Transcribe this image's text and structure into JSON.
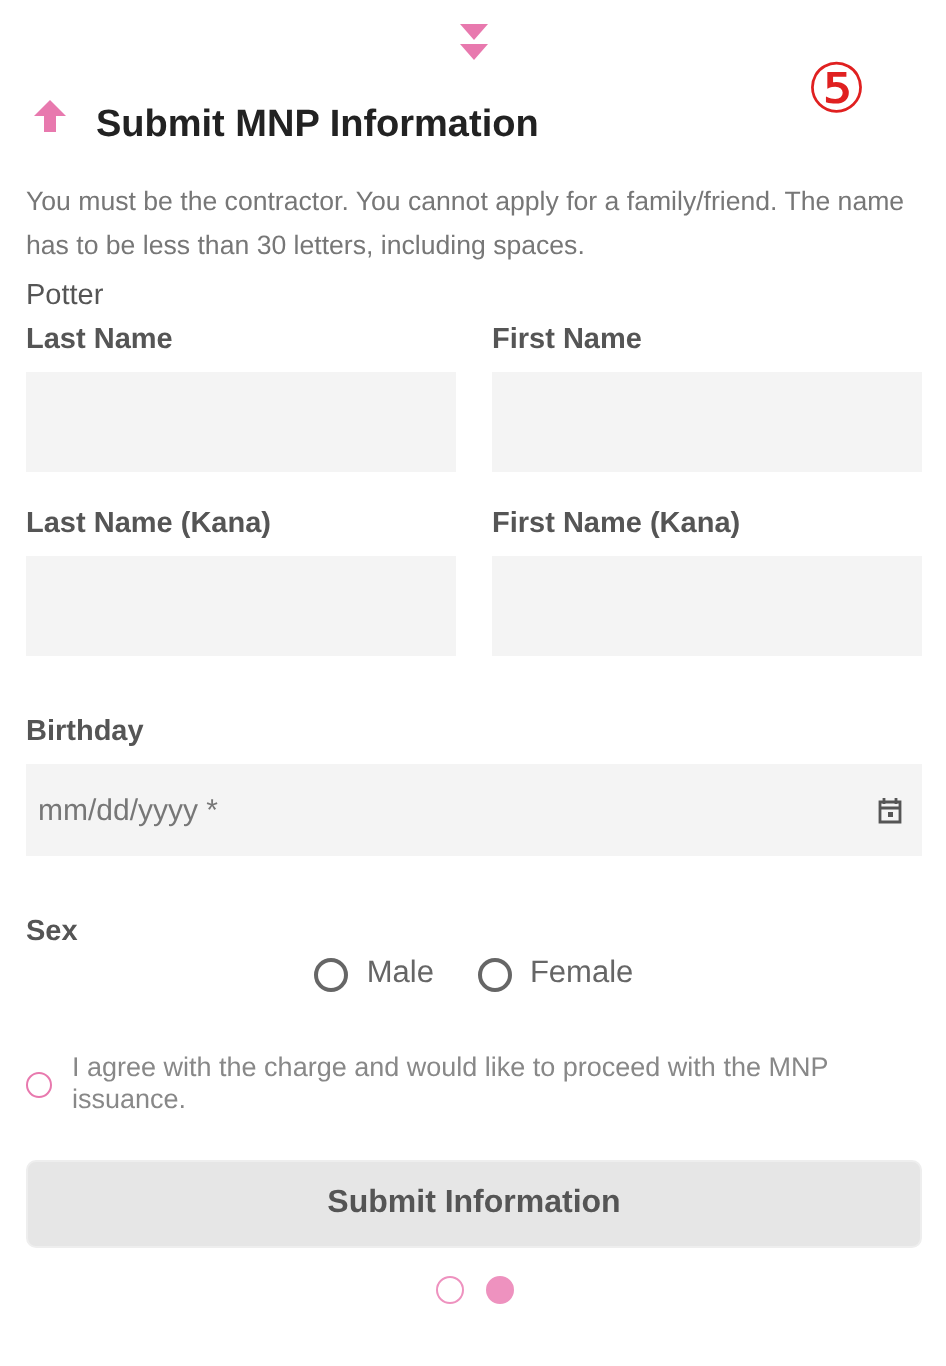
{
  "step_badge": "⑤",
  "title": "Submit MNP Information",
  "description": "You must be the contractor. You cannot apply for a family/friend. The name has to be less than 30 letters, including spaces.",
  "name_hint": "Potter",
  "name_fields": [
    {
      "label": "Last Name"
    },
    {
      "label": "First Name"
    },
    {
      "label": "Last Name (Kana)"
    },
    {
      "label": "First Name (Kana)"
    }
  ],
  "birthday": {
    "label": "Birthday",
    "placeholder": "mm/dd/yyyy *"
  },
  "sex": {
    "label": "Sex",
    "options": [
      {
        "label": "Male",
        "selected": false
      },
      {
        "label": "Female",
        "selected": false
      }
    ]
  },
  "agreement": {
    "text": "I agree with the charge and would like to proceed with the MNP issuance.",
    "checked": false
  },
  "submit_button": {
    "label": "Submit Information",
    "disabled": true
  },
  "pager": [
    {
      "selected": false
    },
    {
      "selected": true
    }
  ]
}
